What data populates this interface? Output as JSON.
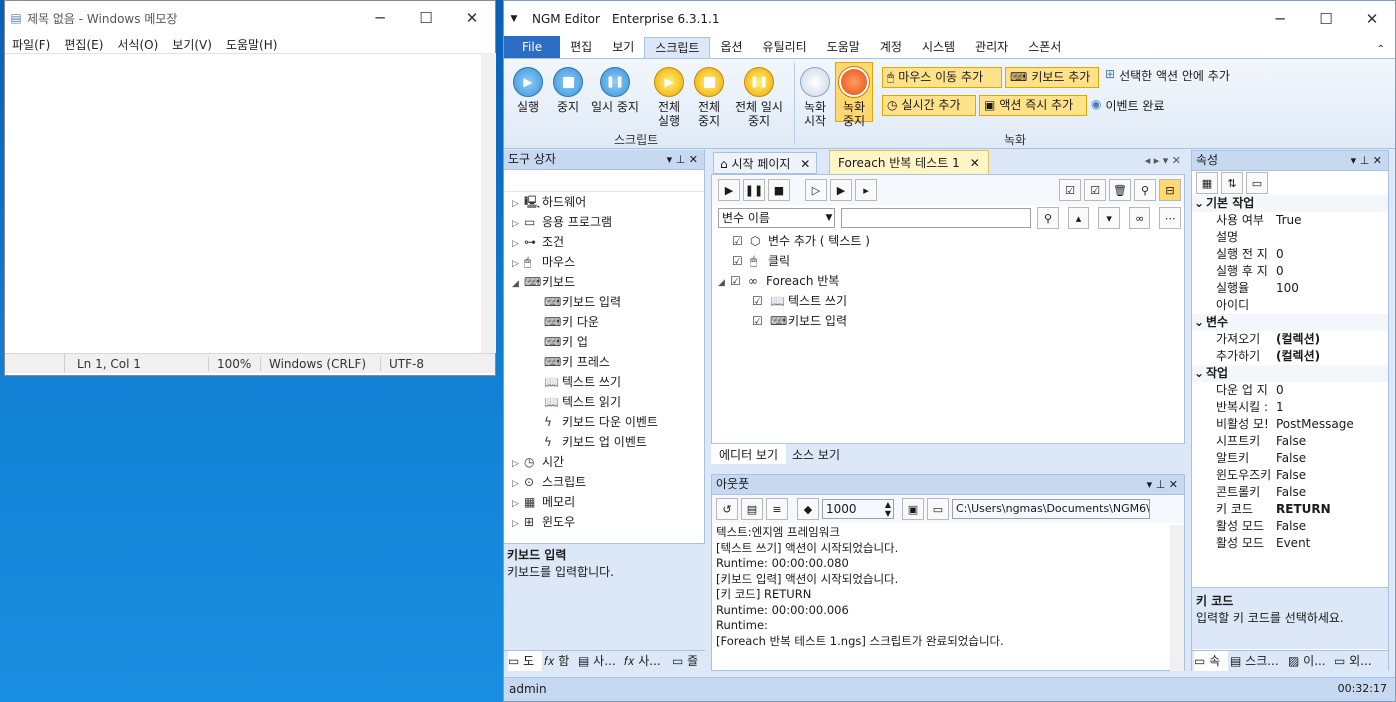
{
  "notepad": {
    "title": "제목 없음 - Windows 메모장",
    "menu": [
      "파일(F)",
      "편집(E)",
      "서식(O)",
      "보기(V)",
      "도움말(H)"
    ],
    "status": {
      "position": "Ln 1, Col 1",
      "zoom": "100%",
      "eol": "Windows (CRLF)",
      "encoding": "UTF-8"
    }
  },
  "ngm": {
    "app": "NGM Editor",
    "edition": "Enterprise 6.3.1.1",
    "tabs": [
      "File",
      "편집",
      "보기",
      "스크립트",
      "옵션",
      "유틸리티",
      "도움말",
      "계정",
      "시스템",
      "관리자",
      "스폰서"
    ],
    "active_tab": "스크립트",
    "ribbon": {
      "run": "실행",
      "stop": "중지",
      "pause": "일시 중지",
      "run_all": "전체 실행",
      "stop_all": "전체 중지",
      "pause_all": "전체 일시 중지",
      "group_script": "스크립트",
      "rec_start": "녹화 시작",
      "rec_stop": "녹화 중지",
      "mouse_move": "마우스 이동 추가",
      "keyboard_add": "키보드 추가",
      "add_into_selected": "선택한 액션 안에 추가",
      "realtime_add": "실시간 추가",
      "action_instant": "액션 즉시 추가",
      "event_done": "이벤트 완료",
      "group_record": "녹화"
    },
    "toolbox": {
      "title": "도구 상자",
      "categories": [
        "하드웨어",
        "응용 프로그램",
        "조건",
        "마우스",
        "키보드"
      ],
      "keyboard_items": [
        "키보드 입력",
        "키 다운",
        "키 업",
        "키 프레스",
        "텍스트 쓰기",
        "텍스트 읽기",
        "키보드 다운 이벤트",
        "키보드 업 이벤트"
      ],
      "more": [
        "시간",
        "스크립트",
        "메모리",
        "윈도우"
      ],
      "desc_title": "키보드 입력",
      "desc": "키보드를 입력합니다.",
      "bottom_tabs": [
        "도",
        "함",
        "사...",
        "사...",
        "즐"
      ]
    },
    "editor": {
      "tab_start": "시작 페이지",
      "tab_doc": "Foreach 반복 테스트 1",
      "var_select": "변수 이름",
      "items": [
        "변수 추가 ( 텍스트 )",
        "클릭",
        "Foreach 반복",
        "텍스트 쓰기",
        "키보드 입력"
      ],
      "view_editor": "에디터 보기",
      "view_source": "소스 보기"
    },
    "output": {
      "title": "아웃풋",
      "count": "1000",
      "path": "C:\\Users\\ngmas\\Documents\\NGM6\\",
      "lines": [
        "텍스트:엔지엠 프레임워크",
        "[텍스트 쓰기] 액션이 시작되었습니다.",
        "Runtime: 00:00:00.080",
        "[키보드 입력] 액션이 시작되었습니다.",
        "[키 코드] RETURN",
        "Runtime: 00:00:00.006",
        "Runtime:",
        "[Foreach 반복 테스트 1.ngs] 스크립트가 완료되었습니다."
      ]
    },
    "props": {
      "title": "속성",
      "cat1": "기본 작업",
      "p1": [
        [
          "사용 여부",
          "True"
        ],
        [
          "설명",
          ""
        ],
        [
          "실행 전 지",
          "0"
        ],
        [
          "실행 후 지",
          "0"
        ],
        [
          "실행율",
          "100"
        ],
        [
          "아이디",
          ""
        ]
      ],
      "cat2": "변수",
      "p2": [
        [
          "가져오기",
          "(컬렉션)"
        ],
        [
          "추가하기",
          "(컬렉션)"
        ]
      ],
      "cat3": "작업",
      "p3": [
        [
          "다운 업 지",
          "0"
        ],
        [
          "반복시킬 :",
          "1"
        ],
        [
          "비활성 모!",
          "PostMessage"
        ],
        [
          "시프트키",
          "False"
        ],
        [
          "알트키",
          "False"
        ],
        [
          "윈도우즈키",
          "False"
        ],
        [
          "콘트롤키",
          "False"
        ],
        [
          "키 코드",
          "RETURN"
        ],
        [
          "활성 모드",
          "False"
        ],
        [
          "활성 모드",
          "Event"
        ]
      ],
      "desc_title": "키 코드",
      "desc": "입력할 키 코드를 선택하세요.",
      "bottom_tabs": [
        "속",
        "스크...",
        "이...",
        "외..."
      ]
    },
    "status": {
      "user": "admin",
      "time": "00:32:17"
    }
  }
}
